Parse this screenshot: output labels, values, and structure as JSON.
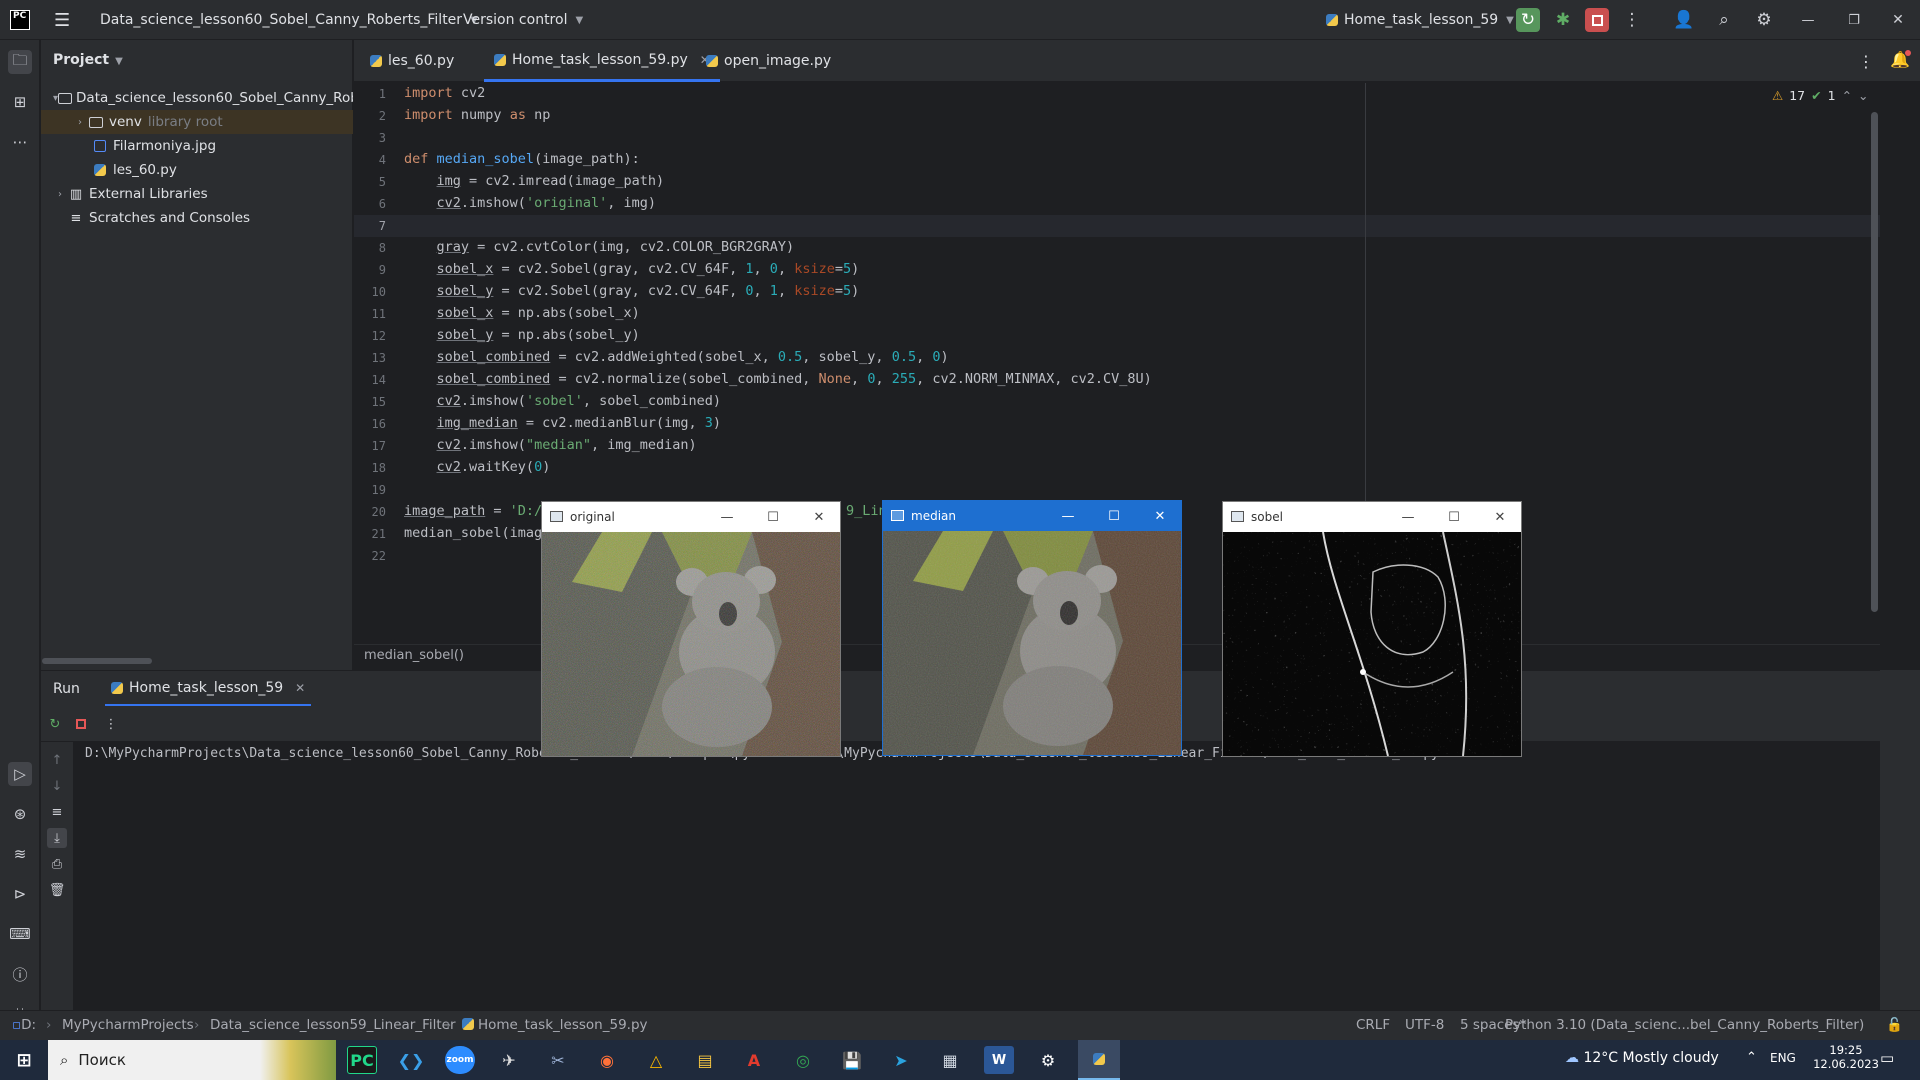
{
  "titlebar": {
    "logo": "PC",
    "project_name": "Data_science_lesson60_Sobel_Canny_Roberts_Filter",
    "vcs": "Version control",
    "run_config": "Home_task_lesson_59"
  },
  "project_panel": {
    "header": "Project",
    "items": [
      {
        "label": "Data_science_lesson60_Sobel_Canny_Rob",
        "extra": ""
      },
      {
        "label": "venv",
        "extra": "library root"
      },
      {
        "label": "Filarmoniya.jpg",
        "extra": ""
      },
      {
        "label": "les_60.py",
        "extra": ""
      },
      {
        "label": "External Libraries",
        "extra": ""
      },
      {
        "label": "Scratches and Consoles",
        "extra": ""
      }
    ]
  },
  "tabs": [
    {
      "label": "les_60.py"
    },
    {
      "label": "Home_task_lesson_59.py"
    },
    {
      "label": "open_image.py"
    }
  ],
  "editor": {
    "warnings": "17",
    "ok_count": "1",
    "breadcrumb": "median_sobel()",
    "line_numbers": [
      "1",
      "2",
      "3",
      "4",
      "5",
      "6",
      "7",
      "8",
      "9",
      "10",
      "11",
      "12",
      "13",
      "14",
      "15",
      "16",
      "17",
      "18",
      "19",
      "20",
      "21",
      "22"
    ],
    "visible_fragment": "9_Lin"
  },
  "run": {
    "title": "Run",
    "tab": "Home_task_lesson_59",
    "console_line": "D:\\MyPycharmProjects\\Data_science_lesson60_Sobel_Canny_Roberts_Filter\\venv\\Scripts\\python.exe D:\\MyPycharmProjects\\Data_science_lesson59_Linear_Filter\\Home_task_lesson_59.py"
  },
  "cv_windows": [
    {
      "title": "original"
    },
    {
      "title": "median"
    },
    {
      "title": "sobel"
    }
  ],
  "statusbar": {
    "drive": "D:",
    "path1": "MyPycharmProjects",
    "path2": "Data_science_lesson59_Linear_Filter",
    "file": "Home_task_lesson_59.py",
    "line_sep": "CRLF",
    "encoding": "UTF-8",
    "indent": "5 spaces*",
    "interpreter": "Python 3.10 (Data_scienc...bel_Canny_Roberts_Filter)"
  },
  "taskbar": {
    "search_placeholder": "Поиск",
    "weather": "12°C  Mostly cloudy",
    "lang": "ENG",
    "time": "19:25",
    "date": "12.06.2023"
  }
}
